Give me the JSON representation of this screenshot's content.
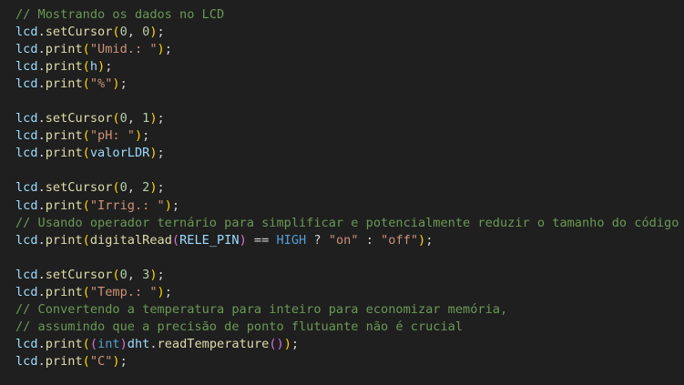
{
  "theme": {
    "background": "#1f1f1f",
    "default": "#d4d4d4",
    "comment": "#6a9955",
    "variable": "#9cdcfe",
    "function": "#dcdcaa",
    "number": "#b5cea8",
    "string": "#ce9178",
    "keyword": "#569cd6",
    "bracket_level1": "#ffd700",
    "bracket_level2": "#da70d6"
  },
  "code_lines": [
    [
      [
        "comment",
        "// Mostrando os dados no LCD"
      ]
    ],
    [
      [
        "var",
        "lcd"
      ],
      [
        "punct",
        "."
      ],
      [
        "func",
        "setCursor"
      ],
      [
        "brk1",
        "("
      ],
      [
        "num",
        "0"
      ],
      [
        "punct",
        ", "
      ],
      [
        "num",
        "0"
      ],
      [
        "brk1",
        ")"
      ],
      [
        "punct",
        ";"
      ]
    ],
    [
      [
        "var",
        "lcd"
      ],
      [
        "punct",
        "."
      ],
      [
        "func",
        "print"
      ],
      [
        "brk1",
        "("
      ],
      [
        "str",
        "\"Umid.: \""
      ],
      [
        "brk1",
        ")"
      ],
      [
        "punct",
        ";"
      ]
    ],
    [
      [
        "var",
        "lcd"
      ],
      [
        "punct",
        "."
      ],
      [
        "func",
        "print"
      ],
      [
        "brk1",
        "("
      ],
      [
        "var",
        "h"
      ],
      [
        "brk1",
        ")"
      ],
      [
        "punct",
        ";"
      ]
    ],
    [
      [
        "var",
        "lcd"
      ],
      [
        "punct",
        "."
      ],
      [
        "func",
        "print"
      ],
      [
        "brk1",
        "("
      ],
      [
        "str",
        "\"%\""
      ],
      [
        "brk1",
        ")"
      ],
      [
        "punct",
        ";"
      ]
    ],
    [],
    [
      [
        "var",
        "lcd"
      ],
      [
        "punct",
        "."
      ],
      [
        "func",
        "setCursor"
      ],
      [
        "brk1",
        "("
      ],
      [
        "num",
        "0"
      ],
      [
        "punct",
        ", "
      ],
      [
        "num",
        "1"
      ],
      [
        "brk1",
        ")"
      ],
      [
        "punct",
        ";"
      ]
    ],
    [
      [
        "var",
        "lcd"
      ],
      [
        "punct",
        "."
      ],
      [
        "func",
        "print"
      ],
      [
        "brk1",
        "("
      ],
      [
        "str",
        "\"pH: \""
      ],
      [
        "brk1",
        ")"
      ],
      [
        "punct",
        ";"
      ]
    ],
    [
      [
        "var",
        "lcd"
      ],
      [
        "punct",
        "."
      ],
      [
        "func",
        "print"
      ],
      [
        "brk1",
        "("
      ],
      [
        "var",
        "valorLDR"
      ],
      [
        "brk1",
        ")"
      ],
      [
        "punct",
        ";"
      ]
    ],
    [],
    [
      [
        "var",
        "lcd"
      ],
      [
        "punct",
        "."
      ],
      [
        "func",
        "setCursor"
      ],
      [
        "brk1",
        "("
      ],
      [
        "num",
        "0"
      ],
      [
        "punct",
        ", "
      ],
      [
        "num",
        "2"
      ],
      [
        "brk1",
        ")"
      ],
      [
        "punct",
        ";"
      ]
    ],
    [
      [
        "var",
        "lcd"
      ],
      [
        "punct",
        "."
      ],
      [
        "func",
        "print"
      ],
      [
        "brk1",
        "("
      ],
      [
        "str",
        "\"Irrig.: \""
      ],
      [
        "brk1",
        ")"
      ],
      [
        "punct",
        ";"
      ]
    ],
    [
      [
        "comment",
        "// Usando operador ternário para simplificar e potencialmente reduzir o tamanho do código"
      ]
    ],
    [
      [
        "var",
        "lcd"
      ],
      [
        "punct",
        "."
      ],
      [
        "func",
        "print"
      ],
      [
        "brk1",
        "("
      ],
      [
        "func",
        "digitalRead"
      ],
      [
        "brk2",
        "("
      ],
      [
        "var",
        "RELE_PIN"
      ],
      [
        "brk2",
        ")"
      ],
      [
        "op",
        " == "
      ],
      [
        "macro",
        "HIGH"
      ],
      [
        "op",
        " ? "
      ],
      [
        "str",
        "\"on\""
      ],
      [
        "op",
        " : "
      ],
      [
        "str",
        "\"off\""
      ],
      [
        "brk1",
        ")"
      ],
      [
        "punct",
        ";"
      ]
    ],
    [],
    [
      [
        "var",
        "lcd"
      ],
      [
        "punct",
        "."
      ],
      [
        "func",
        "setCursor"
      ],
      [
        "brk1",
        "("
      ],
      [
        "num",
        "0"
      ],
      [
        "punct",
        ", "
      ],
      [
        "num",
        "3"
      ],
      [
        "brk1",
        ")"
      ],
      [
        "punct",
        ";"
      ]
    ],
    [
      [
        "var",
        "lcd"
      ],
      [
        "punct",
        "."
      ],
      [
        "func",
        "print"
      ],
      [
        "brk1",
        "("
      ],
      [
        "str",
        "\"Temp.: \""
      ],
      [
        "brk1",
        ")"
      ],
      [
        "punct",
        ";"
      ]
    ],
    [
      [
        "comment",
        "// Convertendo a temperatura para inteiro para economizar memória,"
      ]
    ],
    [
      [
        "comment",
        "// assumindo que a precisão de ponto flutuante não é crucial"
      ]
    ],
    [
      [
        "var",
        "lcd"
      ],
      [
        "punct",
        "."
      ],
      [
        "func",
        "print"
      ],
      [
        "brk1",
        "("
      ],
      [
        "brk2",
        "("
      ],
      [
        "type",
        "int"
      ],
      [
        "brk2",
        ")"
      ],
      [
        "var",
        "dht"
      ],
      [
        "punct",
        "."
      ],
      [
        "func",
        "readTemperature"
      ],
      [
        "brk2",
        "("
      ],
      [
        "brk2",
        ")"
      ],
      [
        "brk1",
        ")"
      ],
      [
        "punct",
        ";"
      ]
    ],
    [
      [
        "var",
        "lcd"
      ],
      [
        "punct",
        "."
      ],
      [
        "func",
        "print"
      ],
      [
        "brk1",
        "("
      ],
      [
        "str",
        "\"C\""
      ],
      [
        "brk1",
        ")"
      ],
      [
        "punct",
        ";"
      ]
    ]
  ]
}
